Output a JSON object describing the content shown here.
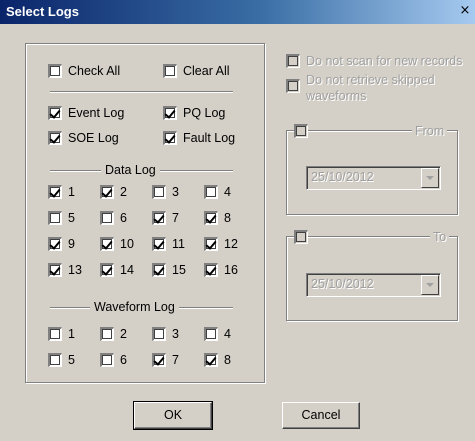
{
  "window": {
    "title": "Select Logs",
    "close_glyph": "×"
  },
  "checks": {
    "check_all": {
      "label": "Check All",
      "checked": false
    },
    "clear_all": {
      "label": "Clear All",
      "checked": false
    },
    "event_log": {
      "label": "Event Log",
      "checked": true
    },
    "pq_log": {
      "label": "PQ Log",
      "checked": true
    },
    "soe_log": {
      "label": "SOE Log",
      "checked": true
    },
    "fault_log": {
      "label": "Fault Log",
      "checked": true
    }
  },
  "data_log": {
    "label": "Data Log",
    "items": [
      {
        "label": "1",
        "checked": true
      },
      {
        "label": "2",
        "checked": true
      },
      {
        "label": "3",
        "checked": false
      },
      {
        "label": "4",
        "checked": false
      },
      {
        "label": "5",
        "checked": false
      },
      {
        "label": "6",
        "checked": false
      },
      {
        "label": "7",
        "checked": true
      },
      {
        "label": "8",
        "checked": true
      },
      {
        "label": "9",
        "checked": true
      },
      {
        "label": "10",
        "checked": true
      },
      {
        "label": "11",
        "checked": true
      },
      {
        "label": "12",
        "checked": true
      },
      {
        "label": "13",
        "checked": true
      },
      {
        "label": "14",
        "checked": true
      },
      {
        "label": "15",
        "checked": true
      },
      {
        "label": "16",
        "checked": true
      }
    ]
  },
  "waveform_log": {
    "label": "Waveform Log",
    "items": [
      {
        "label": "1",
        "checked": false
      },
      {
        "label": "2",
        "checked": false
      },
      {
        "label": "3",
        "checked": false
      },
      {
        "label": "4",
        "checked": false
      },
      {
        "label": "5",
        "checked": false
      },
      {
        "label": "6",
        "checked": false
      },
      {
        "label": "7",
        "checked": true
      },
      {
        "label": "8",
        "checked": true
      }
    ]
  },
  "options": {
    "no_scan": {
      "label": "Do not scan for new records",
      "checked": false,
      "enabled": false
    },
    "no_retrieve": {
      "label": "Do not retrieve skipped waveforms",
      "checked": false,
      "enabled": false
    }
  },
  "from_group": {
    "label": "From",
    "checked": false,
    "date": "25/10/2012"
  },
  "to_group": {
    "label": "To",
    "checked": false,
    "date": "25/10/2012"
  },
  "buttons": {
    "ok": "OK",
    "cancel": "Cancel"
  },
  "colors": {
    "face": "#d4d0c8",
    "title_start": "#0a246a",
    "title_end": "#a6caf0",
    "disabled_text": "#a0a0a0"
  }
}
